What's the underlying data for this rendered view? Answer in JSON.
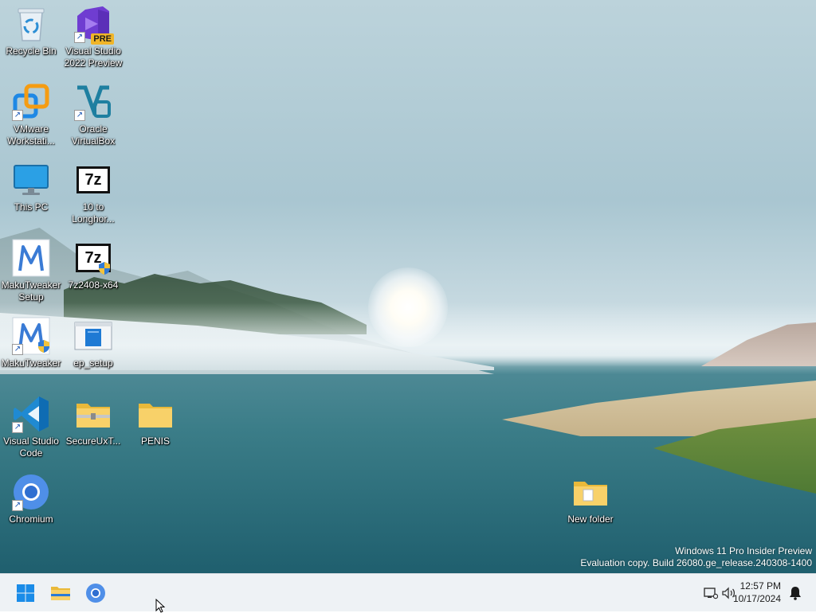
{
  "desktop": {
    "icons": [
      {
        "label": "Recycle Bin",
        "icon": "recycle-bin-icon",
        "shortcut": false
      },
      {
        "label": "Visual Studio 2022 Preview",
        "icon": "visual-studio-icon",
        "shortcut": true,
        "badge": "PRE"
      },
      {
        "label": "VMware Workstati...",
        "icon": "vmware-icon",
        "shortcut": true
      },
      {
        "label": "Oracle VirtualBox",
        "icon": "virtualbox-icon",
        "shortcut": true
      },
      {
        "label": "This PC",
        "icon": "monitor-icon",
        "shortcut": false
      },
      {
        "label": "10 to Longhor...",
        "icon": "7zip-icon",
        "shortcut": false,
        "glyph": "7z"
      },
      {
        "label": "MakuTweaker Setup",
        "icon": "makutweaker-icon",
        "shortcut": false
      },
      {
        "label": "7z2408-x64",
        "icon": "7zip-installer-icon",
        "shortcut": false,
        "glyph": "7z"
      },
      {
        "label": "MakuTweaker",
        "icon": "makutweaker-shield-icon",
        "shortcut": true
      },
      {
        "label": "ep_setup",
        "icon": "installer-window-icon",
        "shortcut": false
      },
      {
        "label": "Visual Studio Code",
        "icon": "vscode-icon",
        "shortcut": true
      },
      {
        "label": "SecureUxT...",
        "icon": "zip-folder-icon",
        "shortcut": false
      },
      {
        "label": "PENIS",
        "icon": "folder-icon",
        "shortcut": false
      },
      {
        "label": "Chromium",
        "icon": "chromium-icon",
        "shortcut": true
      },
      {
        "label": "New folder",
        "icon": "folder-icon",
        "shortcut": false
      }
    ]
  },
  "watermark": {
    "line1": "Windows 11 Pro Insider Preview",
    "line2": "Evaluation copy. Build 26080.ge_release.240308-1400"
  },
  "taskbar": {
    "pinned": [
      {
        "name": "start-button",
        "icon": "windows-logo-icon"
      },
      {
        "name": "file-explorer-button",
        "icon": "folder-icon"
      },
      {
        "name": "chromium-button",
        "icon": "chromium-icon"
      }
    ],
    "tray": {
      "time": "12:57 PM",
      "date": "10/17/2024",
      "icons": [
        "network-icon",
        "volume-icon",
        "notification-bell-icon"
      ]
    }
  },
  "colors": {
    "taskbar_bg": "#eef2f5",
    "windows_blue": "#0078d4",
    "folder_yellow": "#f8d169"
  }
}
